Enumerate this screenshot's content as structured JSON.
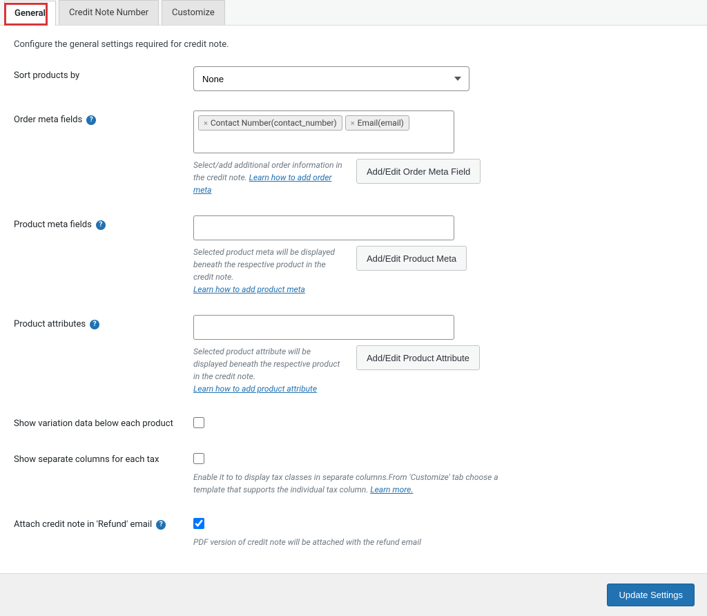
{
  "tabs": {
    "general": "General",
    "creditnote": "Credit Note Number",
    "customize": "Customize"
  },
  "intro": "Configure the general settings required for credit note.",
  "sort": {
    "label": "Sort products by",
    "value": "None"
  },
  "orderMeta": {
    "label": "Order meta fields",
    "tags": {
      "0": "Contact Number(contact_number)",
      "1": "Email(email)"
    },
    "hintPre": "Select/add additional order information in the credit note. ",
    "hintLink": "Learn how to add order meta",
    "button": "Add/Edit Order Meta Field"
  },
  "productMeta": {
    "label": "Product meta fields",
    "hintPre": "Selected product meta will be displayed beneath the respective product in the credit note.",
    "hintLink": "Learn how to add product meta",
    "button": "Add/Edit Product Meta"
  },
  "productAttr": {
    "label": "Product attributes",
    "hintPre": "Selected product attribute will be displayed beneath the respective product in the credit note.",
    "hintLink": "Learn how to add product attribute",
    "button": "Add/Edit Product Attribute"
  },
  "variation": {
    "label": "Show variation data below each product"
  },
  "taxColumns": {
    "label": "Show separate columns for each tax",
    "descPre": "Enable it to to display tax classes in separate columns.From 'Customize' tab choose a template that supports the individual tax column. ",
    "descLink": "Learn more."
  },
  "attachEmail": {
    "label": "Attach credit note in 'Refund' email",
    "desc": "PDF version of credit note will be attached with the refund email"
  },
  "updateBtn": "Update Settings"
}
